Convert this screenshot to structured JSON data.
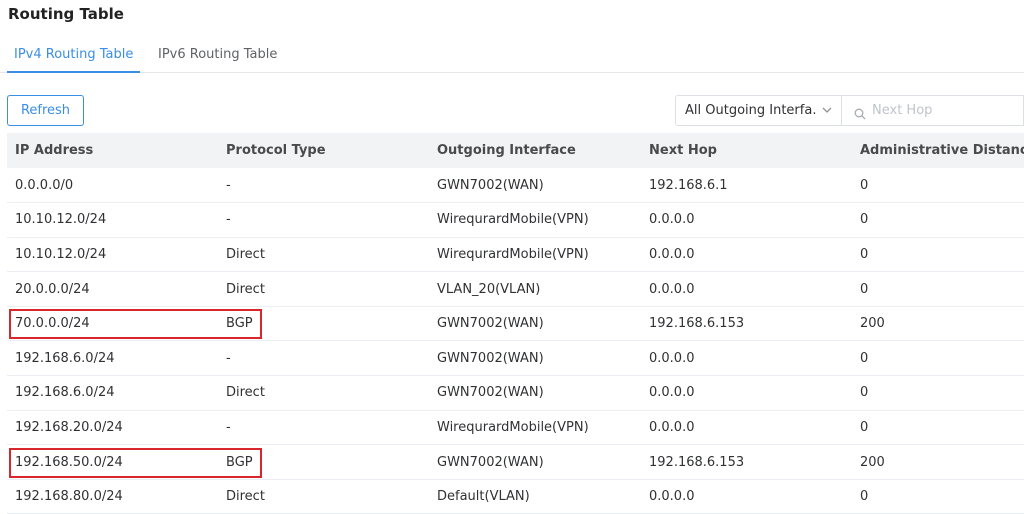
{
  "page": {
    "title": "Routing Table"
  },
  "tabs": [
    {
      "label": "IPv4 Routing Table",
      "active": true
    },
    {
      "label": "IPv6 Routing Table",
      "active": false
    }
  ],
  "toolbar": {
    "refresh_label": "Refresh",
    "interface_filter_value": "All Outgoing Interfa...",
    "search_placeholder": "Next Hop"
  },
  "icons": {
    "dropdown": "chevron-down-icon",
    "search": "search-icon"
  },
  "colors": {
    "accent": "#3a8ee6",
    "highlight": "#d9262c",
    "header_bg": "#f2f3f5"
  },
  "table": {
    "columns": [
      "IP Address",
      "Protocol Type",
      "Outgoing Interface",
      "Next Hop",
      "Administrative Distance"
    ],
    "rows": [
      [
        "0.0.0.0/0",
        "-",
        "GWN7002(WAN)",
        "192.168.6.1",
        "0"
      ],
      [
        "10.10.12.0/24",
        "-",
        "WirequrardMobile(VPN)",
        "0.0.0.0",
        "0"
      ],
      [
        "10.10.12.0/24",
        "Direct",
        "WirequrardMobile(VPN)",
        "0.0.0.0",
        "0"
      ],
      [
        "20.0.0.0/24",
        "Direct",
        "VLAN_20(VLAN)",
        "0.0.0.0",
        "0"
      ],
      [
        "70.0.0.0/24",
        "BGP",
        "GWN7002(WAN)",
        "192.168.6.153",
        "200"
      ],
      [
        "192.168.6.0/24",
        "-",
        "GWN7002(WAN)",
        "0.0.0.0",
        "0"
      ],
      [
        "192.168.6.0/24",
        "Direct",
        "GWN7002(WAN)",
        "0.0.0.0",
        "0"
      ],
      [
        "192.168.20.0/24",
        "-",
        "WirequrardMobile(VPN)",
        "0.0.0.0",
        "0"
      ],
      [
        "192.168.50.0/24",
        "BGP",
        "GWN7002(WAN)",
        "192.168.6.153",
        "200"
      ],
      [
        "192.168.80.0/24",
        "Direct",
        "Default(VLAN)",
        "0.0.0.0",
        "0"
      ]
    ],
    "highlighted_rows": [
      4,
      8
    ]
  }
}
